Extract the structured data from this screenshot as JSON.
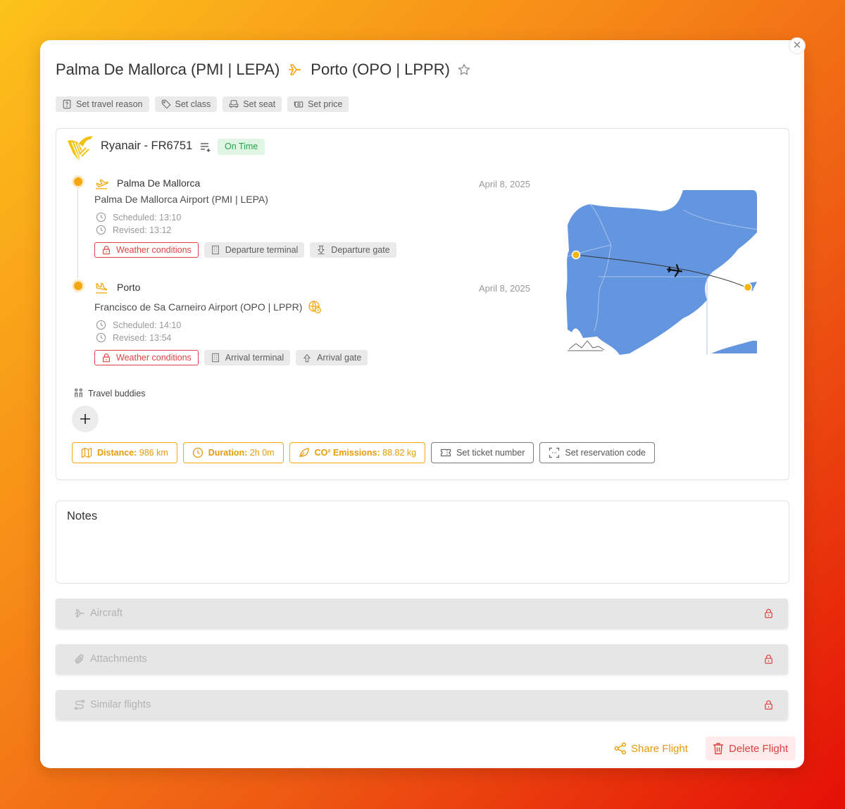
{
  "header": {
    "origin": "Palma De Mallorca (PMI | LEPA)",
    "destination": "Porto (OPO | LPPR)",
    "close_icon": "close-icon",
    "favorite_icon": "star-icon"
  },
  "quick_actions": [
    {
      "label": "Set travel reason",
      "icon": "question-icon"
    },
    {
      "label": "Set class",
      "icon": "tag-icon"
    },
    {
      "label": "Set seat",
      "icon": "seat-icon"
    },
    {
      "label": "Set price",
      "icon": "money-icon"
    }
  ],
  "flight": {
    "airline": "Ryanair - FR6751",
    "status": "On Time",
    "departure": {
      "city": "Palma De Mallorca",
      "date": "April 8, 2025",
      "airport": "Palma De Mallorca Airport (PMI | LEPA)",
      "scheduled": "Scheduled: 13:10",
      "revised": "Revised: 13:12",
      "delay_reason": "Weather conditions",
      "terminal": "Departure terminal",
      "gate": "Departure gate"
    },
    "arrival": {
      "city": "Porto",
      "date": "April 8, 2025",
      "airport": "Francisco de Sa Carneiro Airport (OPO | LPPR)",
      "scheduled": "Scheduled: 14:10",
      "revised": "Revised: 13:54",
      "delay_reason": "Weather conditions",
      "terminal": "Arrival terminal",
      "gate": "Arrival gate"
    },
    "travel_buddies": "Travel buddies",
    "stats": {
      "distance_label": "Distance:",
      "distance_value": "986 km",
      "duration_label": "Duration:",
      "duration_value": "2h 0m",
      "emissions_label": "CO² Emissions:",
      "emissions_value": "88.82 kg"
    },
    "ticket_button": "Set ticket number",
    "reservation_button": "Set reservation code"
  },
  "notes": {
    "title": "Notes"
  },
  "sections": [
    {
      "label": "Aircraft",
      "icon": "plane-icon"
    },
    {
      "label": "Attachments",
      "icon": "paperclip-icon"
    },
    {
      "label": "Similar flights",
      "icon": "route-icon"
    }
  ],
  "footer": {
    "share_label": "Share Flight",
    "delete_label": "Delete Flight"
  },
  "colors": {
    "accent": "#f4a70e",
    "danger": "#e04242",
    "success": "#27a34b",
    "map_land": "#6496e0"
  }
}
